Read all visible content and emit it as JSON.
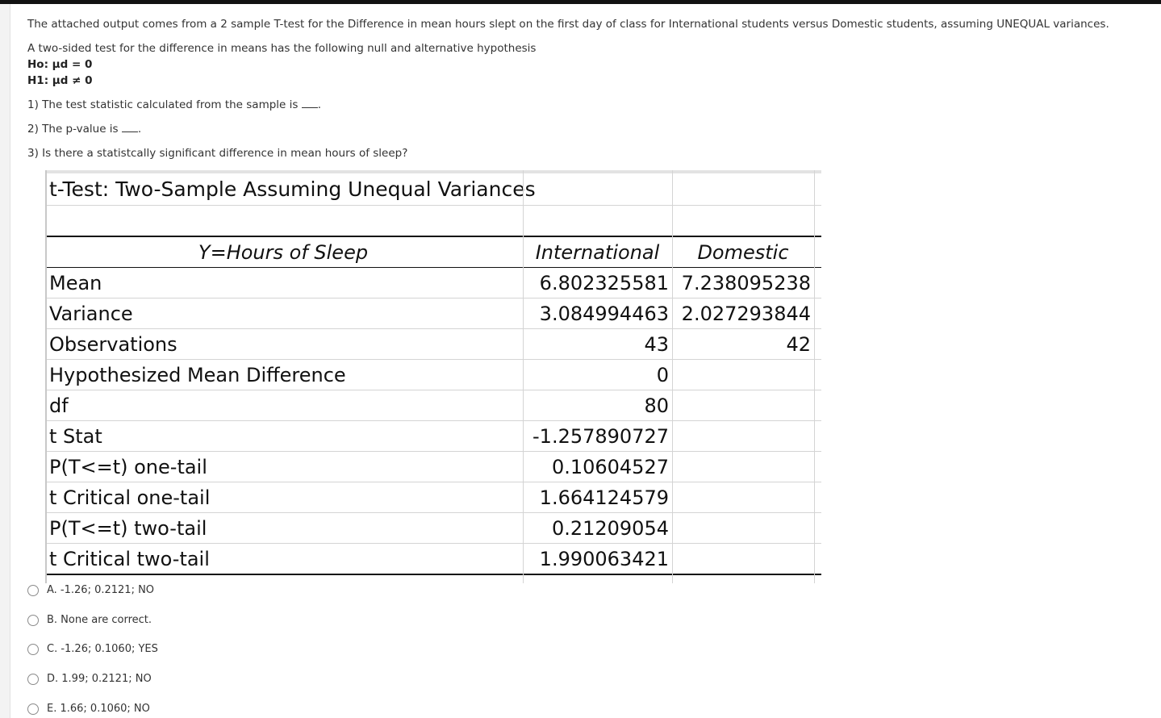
{
  "question": {
    "intro": "The attached output comes from a 2 sample T-test for the Difference in mean hours slept on the first day of class for International students versus Domestic students, assuming UNEQUAL variances.",
    "hypothesis_intro": "A two-sided test for the difference in means has the following null and alternative hypothesis",
    "h0": "Ho: μd = 0",
    "h1": "H1: μd ≠ 0",
    "q1": "1) The test statistic calculated from the sample is",
    "q2": "2) The p-value is",
    "q3": "3) Is there a statistcally significant difference in mean hours of sleep?"
  },
  "table": {
    "title": "t-Test: Two-Sample Assuming Unequal Variances",
    "header": {
      "label": "Y=Hours of Sleep",
      "col1": "International",
      "col2": "Domestic"
    },
    "rows": [
      {
        "label": "Mean",
        "international": "6.802325581",
        "domestic": "7.238095238"
      },
      {
        "label": "Variance",
        "international": "3.084994463",
        "domestic": "2.027293844"
      },
      {
        "label": "Observations",
        "international": "43",
        "domestic": "42"
      },
      {
        "label": "Hypothesized Mean Difference",
        "international": "0",
        "domestic": ""
      },
      {
        "label": "df",
        "international": "80",
        "domestic": ""
      },
      {
        "label": "t Stat",
        "international": "-1.257890727",
        "domestic": ""
      },
      {
        "label": "P(T<=t) one-tail",
        "international": "0.10604527",
        "domestic": ""
      },
      {
        "label": "t Critical one-tail",
        "international": "1.664124579",
        "domestic": ""
      },
      {
        "label": "P(T<=t) two-tail",
        "international": "0.21209054",
        "domestic": ""
      },
      {
        "label": "t Critical two-tail",
        "international": "1.990063421",
        "domestic": ""
      }
    ]
  },
  "options": [
    {
      "label": "A. -1.26; 0.2121; NO"
    },
    {
      "label": "B. None are correct."
    },
    {
      "label": "C. -1.26; 0.1060; YES"
    },
    {
      "label": "D. 1.99; 0.2121; NO"
    },
    {
      "label": "E. 1.66; 0.1060; NO"
    }
  ]
}
